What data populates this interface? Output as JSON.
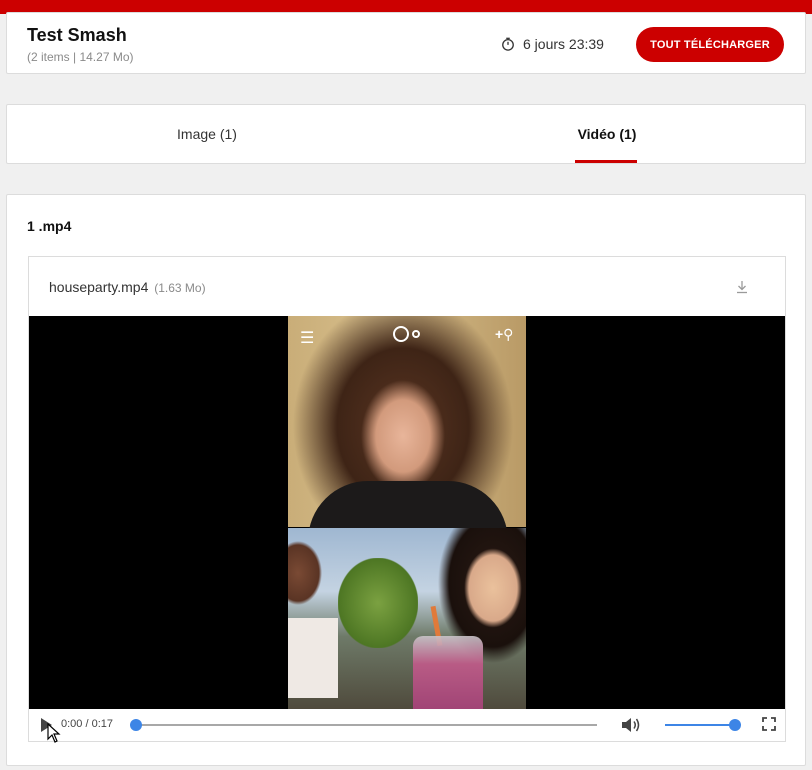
{
  "header": {
    "title": "Test Smash",
    "subtitle": "(2 items | 14.27 Mo)",
    "timer_text": "6 jours 23:39",
    "download_all_label": "TOUT TÉLÉCHARGER"
  },
  "tabs": [
    {
      "label": "Image (1)",
      "active": false
    },
    {
      "label": "Vidéo (1)",
      "active": true
    }
  ],
  "content": {
    "section_title": "1 .mp4",
    "file": {
      "name": "houseparty.mp4",
      "size": "(1.63 Mo)"
    },
    "player": {
      "time": "0:00 / 0:17",
      "progress": 0.0,
      "volume": 1.0
    }
  },
  "colors": {
    "brand": "#cc0000",
    "accent": "#3d85e6"
  },
  "icons": {
    "timer": "stopwatch-icon",
    "download": "download-icon",
    "play": "play-icon",
    "volume": "volume-icon",
    "fullscreen": "fullscreen-icon"
  }
}
